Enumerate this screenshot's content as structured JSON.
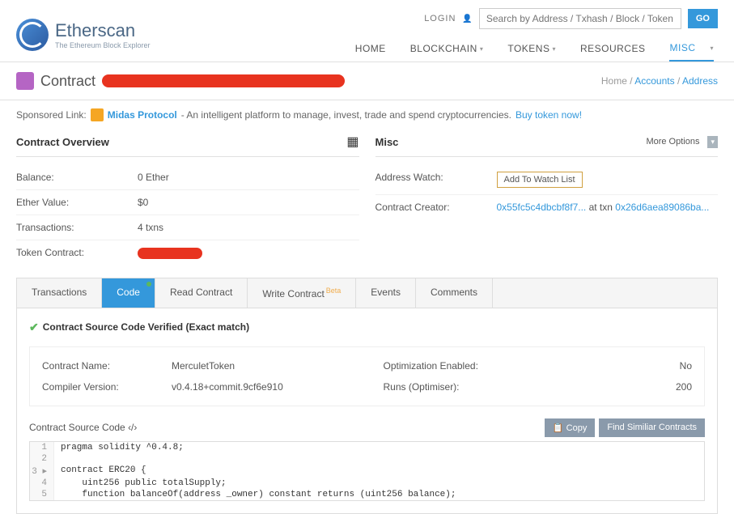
{
  "logo": {
    "title": "Etherscan",
    "subtitle": "The Ethereum Block Explorer"
  },
  "header": {
    "login": "LOGIN",
    "search_placeholder": "Search by Address / Txhash / Block / Token / Ens",
    "go": "GO"
  },
  "nav": {
    "home": "HOME",
    "blockchain": "BLOCKCHAIN",
    "tokens": "TOKENS",
    "resources": "RESOURCES",
    "misc": "MISC"
  },
  "title": "Contract",
  "breadcrumb": {
    "home": "Home",
    "accounts": "Accounts",
    "address": "Address"
  },
  "sponsor": {
    "prefix": "Sponsored Link:",
    "name": "Midas Protocol",
    "desc": " - An intelligent platform to manage, invest, trade and spend cryptocurrencies. ",
    "cta": "Buy token now!"
  },
  "overview": {
    "title": "Contract Overview",
    "balance_label": "Balance:",
    "balance_value": "0 Ether",
    "ethervalue_label": "Ether Value:",
    "ethervalue_value": "$0",
    "txns_label": "Transactions:",
    "txns_value": "4 txns",
    "token_label": "Token Contract:"
  },
  "misc": {
    "title": "Misc",
    "more": "More Options",
    "watch_label": "Address Watch:",
    "watch_btn": "Add To Watch List",
    "creator_label": "Contract Creator:",
    "creator_addr": "0x55fc5c4dbcbf8f7...",
    "at_txn": " at txn ",
    "creator_txn": "0x26d6aea89086ba..."
  },
  "tabs": {
    "transactions": "Transactions",
    "code": "Code",
    "read": "Read Contract",
    "write": "Write Contract",
    "write_beta": "Beta",
    "events": "Events",
    "comments": "Comments"
  },
  "verified": "Contract Source Code Verified (Exact match)",
  "info": {
    "name_label": "Contract Name:",
    "name_value": "MerculetToken",
    "compiler_label": "Compiler Version:",
    "compiler_value": "v0.4.18+commit.9cf6e910",
    "opt_label": "Optimization Enabled:",
    "opt_value": "No",
    "runs_label": "Runs (Optimiser):",
    "runs_value": "200"
  },
  "code": {
    "title": "Contract Source Code ‹/›",
    "copy": "Copy",
    "find": "Find Similiar Contracts",
    "l1": "pragma solidity ^0.4.8;",
    "l2": "",
    "l3": "contract ERC20 {",
    "l4": "    uint256 public totalSupply;",
    "l5": "    function balanceOf(address _owner) constant returns (uint256 balance);"
  }
}
